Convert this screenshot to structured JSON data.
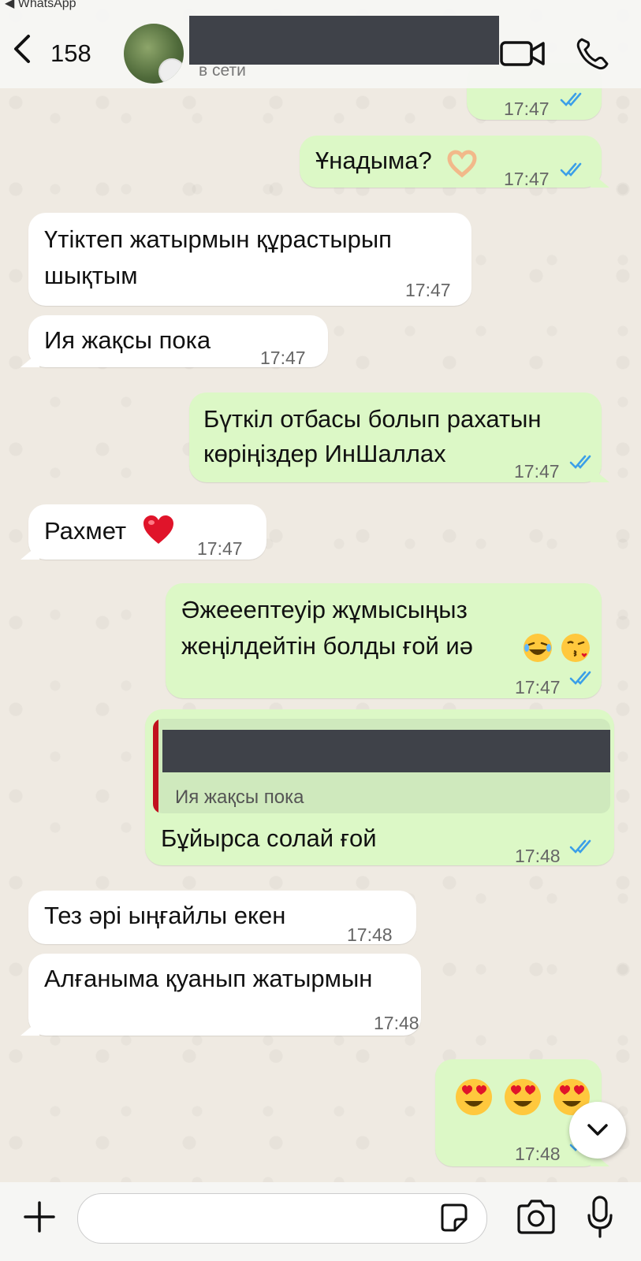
{
  "status_bar": {
    "app_label": "◀ WhatsApp"
  },
  "header": {
    "back_count": "158",
    "presence": "в сети"
  },
  "messages": [
    {
      "dir": "out",
      "text": "",
      "time": "17:47"
    },
    {
      "dir": "out",
      "text": "Ұнадыма?",
      "time": "17:47"
    },
    {
      "dir": "in",
      "line1": "Үтіктеп жатырмын құрастырып",
      "line2": "шықтым",
      "time": "17:47"
    },
    {
      "dir": "in",
      "text": "Ия жақсы пока",
      "time": "17:47"
    },
    {
      "dir": "out",
      "line1": "Бүткіл отбасы болып рахатын",
      "line2": "көріңіздер ИнШаллах",
      "time": "17:47"
    },
    {
      "dir": "in",
      "text": "Рахмет",
      "time": "17:47"
    },
    {
      "dir": "out",
      "line1": "Әжееептеуір жұмысыңыз",
      "line2": "жеңілдейтін болды ғой иә",
      "time": "17:47"
    },
    {
      "dir": "out",
      "quoted": "Ия жақсы пока",
      "text": "Бұйырса солай ғой",
      "time": "17:48"
    },
    {
      "dir": "in",
      "text": "Тез әрі ыңғайлы екен",
      "time": "17:48"
    },
    {
      "dir": "in",
      "text": "Алғаныма қуанып жатырмын",
      "time": "17:48"
    },
    {
      "dir": "out",
      "emoji_count": 3,
      "time": "17:48"
    }
  ],
  "colors": {
    "incoming": "#ffffff",
    "outgoing": "#dcf8c6",
    "read_ticks": "#3b9fe8",
    "quote_bar": "#c1121f"
  },
  "icons": [
    "back-chevron-icon",
    "video-call-icon",
    "phone-call-icon",
    "double-check-icon",
    "heart-emoji-icon",
    "heart-hands-emoji-icon",
    "laughing-emoji-icon",
    "kiss-emoji-icon",
    "heart-eyes-emoji-icon",
    "chevron-down-icon",
    "plus-icon",
    "sticker-icon",
    "camera-icon",
    "mic-icon"
  ]
}
